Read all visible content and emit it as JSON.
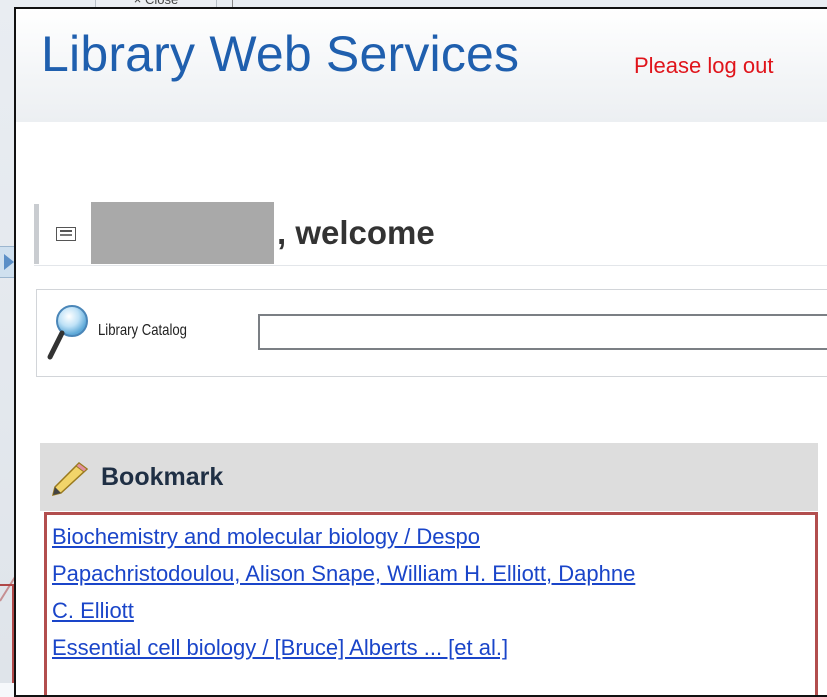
{
  "background": {
    "close_label": "× Close"
  },
  "header": {
    "title": "Library Web Services",
    "logout_note": "Please log out"
  },
  "welcome": {
    "suffix": ", welcome"
  },
  "search": {
    "label": "Library Catalog",
    "value": "",
    "placeholder": ""
  },
  "bookmark": {
    "title": "Bookmark",
    "items": [
      {
        "label": "Biochemistry and molecular biology / Despo"
      },
      {
        "label": "Papachristodoulou, Alison Snape, William H. Elliott, Daphne"
      },
      {
        "label": "C. Elliott"
      },
      {
        "label": "Essential cell biology / [Bruce] Alberts ... [et al.]"
      }
    ]
  },
  "icons": {
    "profile": "id-card-icon",
    "search": "magnifier-icon",
    "bookmark": "pencil-icon"
  },
  "colors": {
    "title": "#1f5fae",
    "logout_note": "#e0141b",
    "link": "#1a45c9",
    "highlight_border": "#b24e4e",
    "bookmark_header_bg": "#dddddd"
  }
}
